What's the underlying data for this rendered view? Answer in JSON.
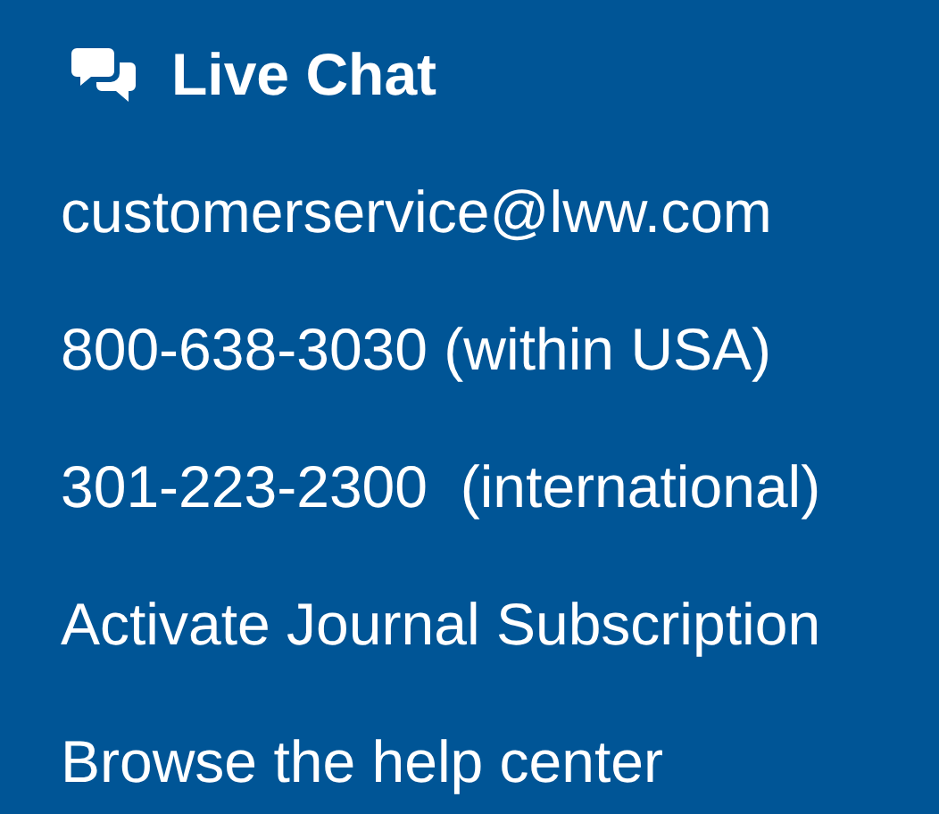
{
  "links": [
    {
      "kind": "chat",
      "label": "Live Chat"
    },
    {
      "kind": "plain",
      "label": "customerservice@lww.com"
    },
    {
      "kind": "plain",
      "label": "800-638-3030 (within USA)"
    },
    {
      "kind": "plain",
      "label": "301-223-2300  (international)"
    },
    {
      "kind": "plain",
      "label": "Activate Journal Subscription"
    },
    {
      "kind": "plain",
      "label": "Browse the help center"
    }
  ]
}
